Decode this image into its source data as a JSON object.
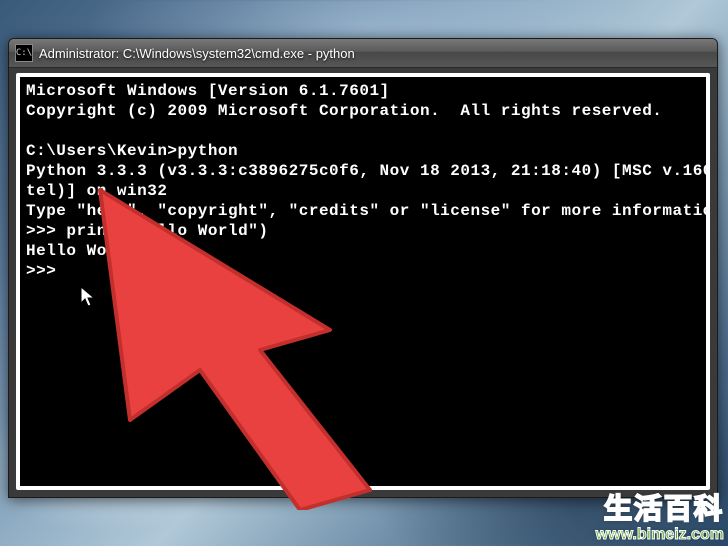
{
  "window": {
    "icon_text": "C:\\",
    "title": "Administrator: C:\\Windows\\system32\\cmd.exe - python"
  },
  "terminal": {
    "lines": [
      "Microsoft Windows [Version 6.1.7601]",
      "Copyright (c) 2009 Microsoft Corporation.  All rights reserved.",
      "",
      "C:\\Users\\Kevin>python",
      "Python 3.3.3 (v3.3.3:c3896275c0f6, Nov 18 2013, 21:18:40) [MSC v.160",
      "tel)] on win32",
      "Type \"help\", \"copyright\", \"credits\" or \"license\" for more informatio",
      ">>> print(\"Hello World\")",
      "Hello World",
      ">>>"
    ]
  },
  "overlay": {
    "arrow_color": "#e8413f",
    "arrow_stroke": "#c22f2d"
  },
  "watermark": {
    "text_cn": "生活百科",
    "url": "www.bimeiz.com"
  }
}
